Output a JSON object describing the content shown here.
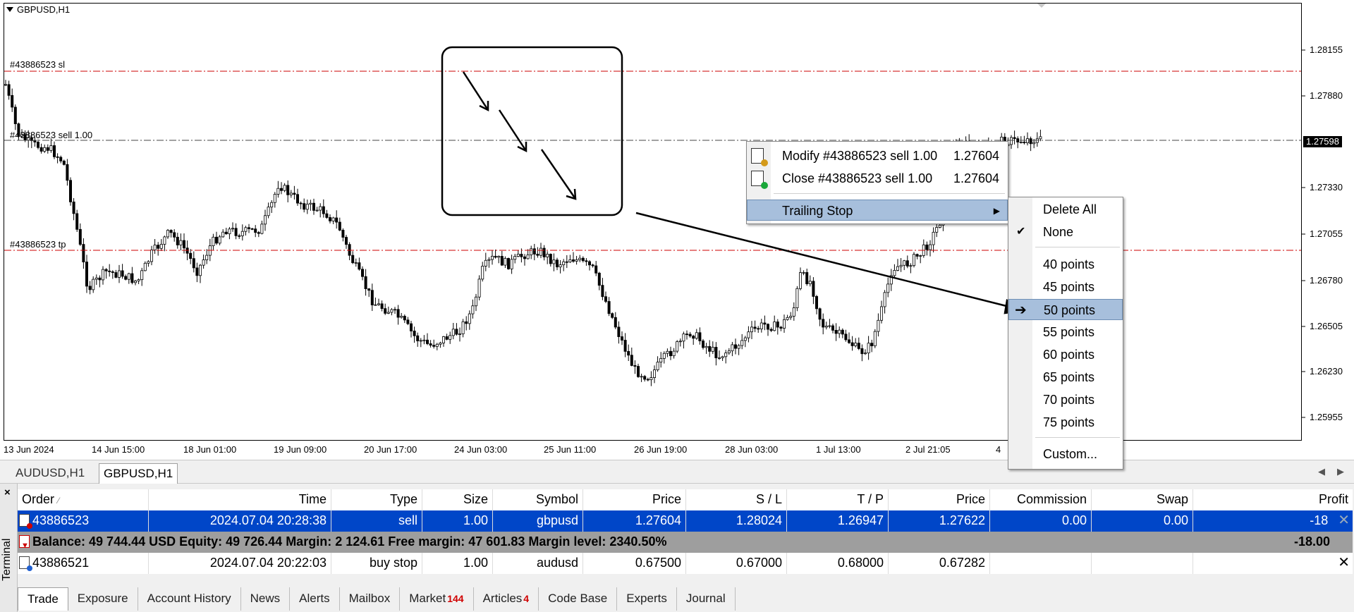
{
  "chart": {
    "symbol_title": "GBPUSD,H1",
    "price_levels": [
      "1.28155",
      "1.27880",
      "1.27330",
      "1.27055",
      "1.26780",
      "1.26505",
      "1.26230",
      "1.25955"
    ],
    "current_price": "1.27598",
    "time_labels": [
      "13 Jun 2024",
      "14 Jun 15:00",
      "18 Jun 01:00",
      "19 Jun 09:00",
      "20 Jun 17:00",
      "24 Jun 03:00",
      "25 Jun 11:00",
      "26 Jun 19:00",
      "28 Jun 03:00",
      "1 Jul 13:00",
      "2 Jul 21:05",
      "4"
    ],
    "order_lines": {
      "sl_label": "#43886523 sl",
      "entry_label": "#43886523 sell 1.00",
      "tp_label": "#43886523 tp"
    },
    "colors": {
      "sl_tp_line": "#cc0000",
      "entry_line": "#555555",
      "candles": "#000000"
    }
  },
  "chart_tabs": [
    "AUDUSD,H1",
    "GBPUSD,H1"
  ],
  "context_menu": {
    "modify_label": "Modify #43886523 sell 1.00",
    "modify_price": "1.27604",
    "close_label": "Close #43886523 sell 1.00",
    "close_price": "1.27604",
    "trailing_stop_label": "Trailing Stop"
  },
  "trailing_submenu": {
    "items": [
      "Delete All",
      "None",
      "40 points",
      "45 points",
      "50 points",
      "55 points",
      "60 points",
      "65 points",
      "70 points",
      "75 points",
      "Custom..."
    ],
    "checked": "None",
    "highlighted": "50 points"
  },
  "terminal": {
    "side_label": "Terminal",
    "close_glyph": "×",
    "columns": [
      "Order",
      "Time",
      "Type",
      "Size",
      "Symbol",
      "Price",
      "S / L",
      "T / P",
      "Price",
      "Commission",
      "Swap",
      "Profit"
    ],
    "sort_glyph": "⁄",
    "rows": [
      {
        "order": "43886523",
        "time": "2024.07.04 20:28:38",
        "type": "sell",
        "size": "1.00",
        "symbol": "gbpusd",
        "price": "1.27604",
        "sl": "1.28024",
        "tp": "1.26947",
        "cur_price": "1.27622",
        "commission": "0.00",
        "swap": "0.00",
        "profit": "-18"
      },
      {
        "order": "43886521",
        "time": "2024.07.04 20:22:03",
        "type": "buy stop",
        "size": "1.00",
        "symbol": "audusd",
        "price": "0.67500",
        "sl": "0.67000",
        "tp": "0.68000",
        "cur_price": "0.67282",
        "commission": "",
        "swap": "",
        "profit": ""
      }
    ],
    "summary": {
      "text": "Balance: 49 744.44 USD  Equity: 49 726.44  Margin: 2 124.61  Free margin: 47 601.83  Margin level: 2340.50%",
      "profit": "-18.00"
    },
    "tabs": [
      {
        "label": "Trade",
        "badge": ""
      },
      {
        "label": "Exposure",
        "badge": ""
      },
      {
        "label": "Account History",
        "badge": ""
      },
      {
        "label": "News",
        "badge": ""
      },
      {
        "label": "Alerts",
        "badge": ""
      },
      {
        "label": "Mailbox",
        "badge": ""
      },
      {
        "label": "Market",
        "badge": "144"
      },
      {
        "label": "Articles",
        "badge": "4"
      },
      {
        "label": "Code Base",
        "badge": ""
      },
      {
        "label": "Experts",
        "badge": ""
      },
      {
        "label": "Journal",
        "badge": ""
      }
    ]
  },
  "icons": [
    "triangle-down-icon",
    "doc-edit-icon",
    "doc-check-icon",
    "submenu-arrow-icon",
    "checkmark-icon",
    "arrow-cursor-icon",
    "sell-order-icon",
    "pending-order-icon",
    "close-x-icon",
    "scroll-left-icon",
    "scroll-right-icon"
  ]
}
